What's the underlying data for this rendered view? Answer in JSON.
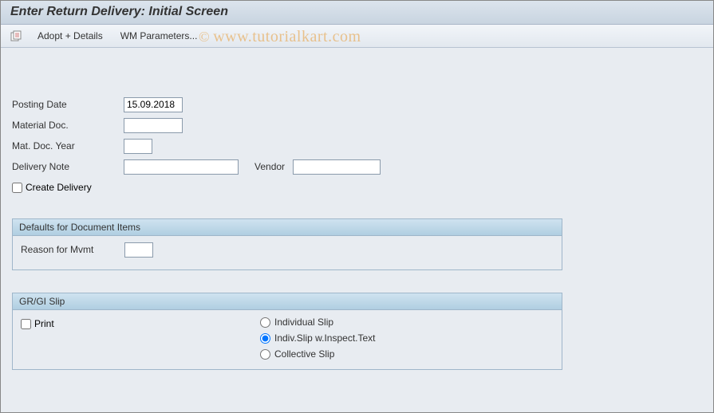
{
  "title": "Enter Return Delivery: Initial Screen",
  "toolbar": {
    "adopt_details": "Adopt + Details",
    "wm_params": "WM Parameters..."
  },
  "watermark": "www.tutorialkart.com",
  "form": {
    "posting_date_label": "Posting Date",
    "posting_date_value": "15.09.2018",
    "material_doc_label": "Material Doc.",
    "material_doc_value": "",
    "mat_doc_year_label": "Mat. Doc. Year",
    "mat_doc_year_value": "",
    "delivery_note_label": "Delivery Note",
    "delivery_note_value": "",
    "vendor_label": "Vendor",
    "vendor_value": "",
    "create_delivery_label": "Create Delivery"
  },
  "defaults_group": {
    "title": "Defaults for Document Items",
    "reason_label": "Reason for Mvmt",
    "reason_value": ""
  },
  "slip_group": {
    "title": "GR/GI Slip",
    "print_label": "Print",
    "radio_individual": "Individual Slip",
    "radio_inspect": "Indiv.Slip w.Inspect.Text",
    "radio_collective": "Collective Slip"
  }
}
